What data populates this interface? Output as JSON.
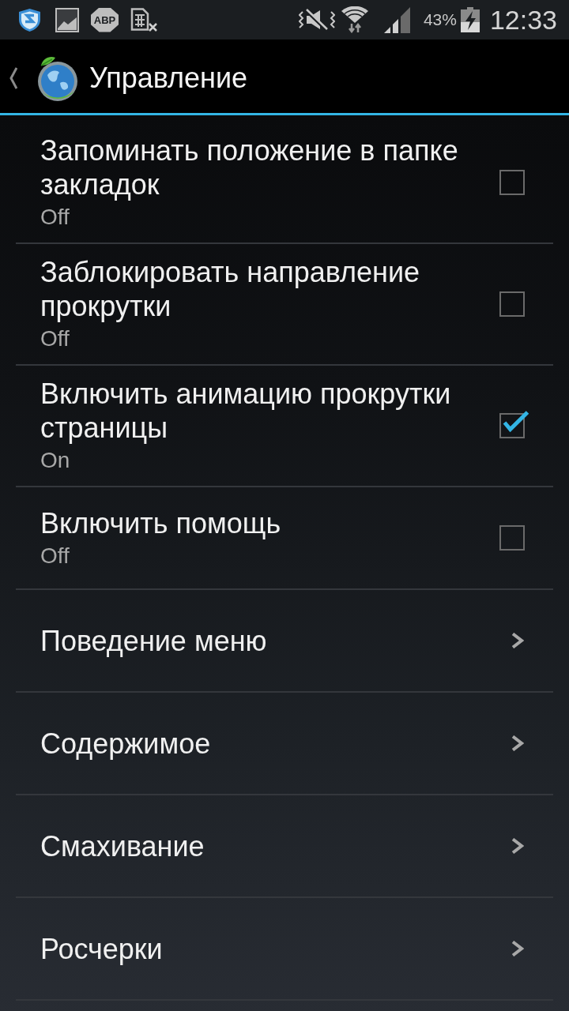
{
  "status_bar": {
    "adblock_label": "ABP",
    "battery": "43%",
    "time": "12:33"
  },
  "action_bar": {
    "title": "Управление"
  },
  "settings": [
    {
      "kind": "checkbox",
      "title": "Запоминать положение в папке закладок",
      "summary": "Off",
      "checked": false
    },
    {
      "kind": "checkbox",
      "title": "Заблокировать направление прокрутки",
      "summary": "Off",
      "checked": false
    },
    {
      "kind": "checkbox",
      "title": "Включить анимацию прокрутки страницы",
      "summary": "On",
      "checked": true
    },
    {
      "kind": "checkbox",
      "title": "Включить помощь",
      "summary": "Off",
      "checked": false
    },
    {
      "kind": "link",
      "title": "Поведение меню"
    },
    {
      "kind": "link",
      "title": "Содержимое"
    },
    {
      "kind": "link",
      "title": "Смахивание"
    },
    {
      "kind": "link",
      "title": "Росчерки"
    }
  ]
}
